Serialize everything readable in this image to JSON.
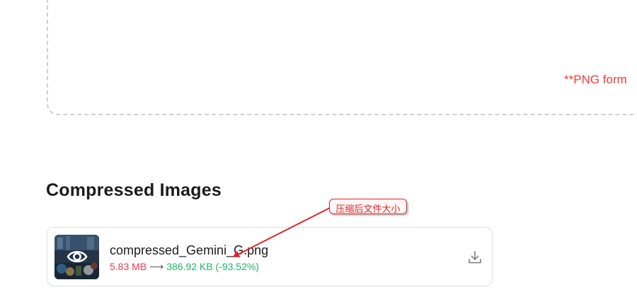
{
  "upload_area": {
    "format_note": "**PNG form"
  },
  "section": {
    "title": "Compressed Images"
  },
  "file": {
    "name": "compressed_Gemini_G.png",
    "original_size": "5.83 MB",
    "arrow": "⟶",
    "new_size": "386.92 KB (-93.52%)"
  },
  "annotation": {
    "callout_text": "压缩后文件大小",
    "color": "#e0252a"
  },
  "colors": {
    "original_size": "#e8394d",
    "new_size": "#1fb46a",
    "format_note": "#ef3b3b"
  },
  "icons": {
    "preview": "eye-icon",
    "download": "download-icon"
  }
}
